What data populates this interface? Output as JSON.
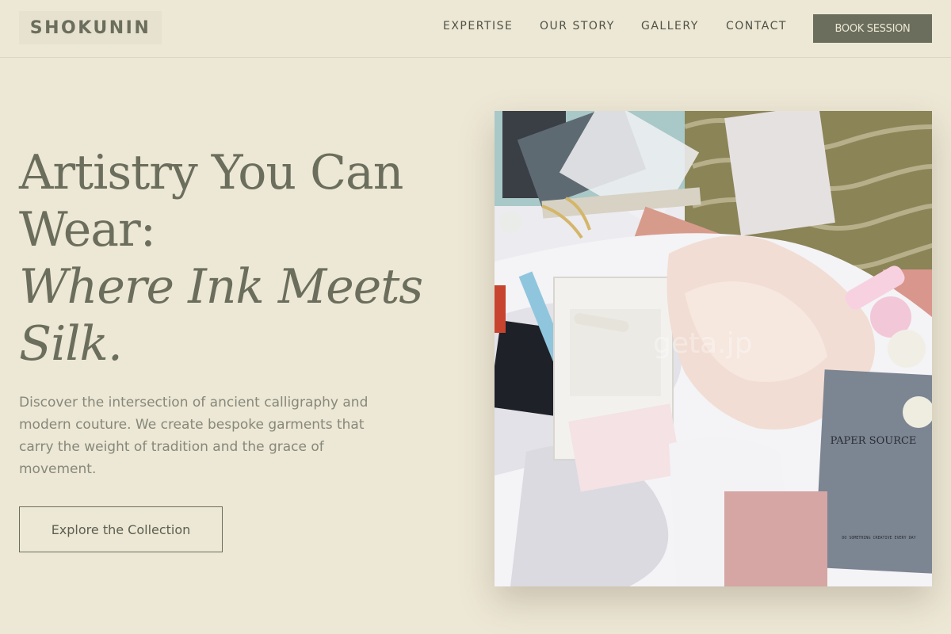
{
  "brand": {
    "name": "SHOKUNIN"
  },
  "nav": {
    "items": [
      {
        "label": "EXPERTISE"
      },
      {
        "label": "OUR STORY"
      },
      {
        "label": "GALLERY"
      },
      {
        "label": "CONTACT"
      }
    ],
    "cta_label": "BOOK SESSION"
  },
  "hero": {
    "title_line1": "Artistry You Can",
    "title_line2": "Wear:",
    "title_italic_line1": "Where Ink Meets",
    "title_italic_line2": "Silk.",
    "description": "Discover the intersection of ancient calligraphy and modern couture. We create bespoke garments that carry the weight of tradition and the grace of movement.",
    "button_label": "Explore the Collection"
  },
  "image": {
    "watermark": "geta.jp",
    "bag_brand": "PAPER SOURCE",
    "bag_tagline": "DO SOMETHING CREATIVE EVERY DAY"
  },
  "colors": {
    "background": "#ede7d5",
    "accent": "#6b6e5c",
    "text_muted": "#86887a"
  }
}
